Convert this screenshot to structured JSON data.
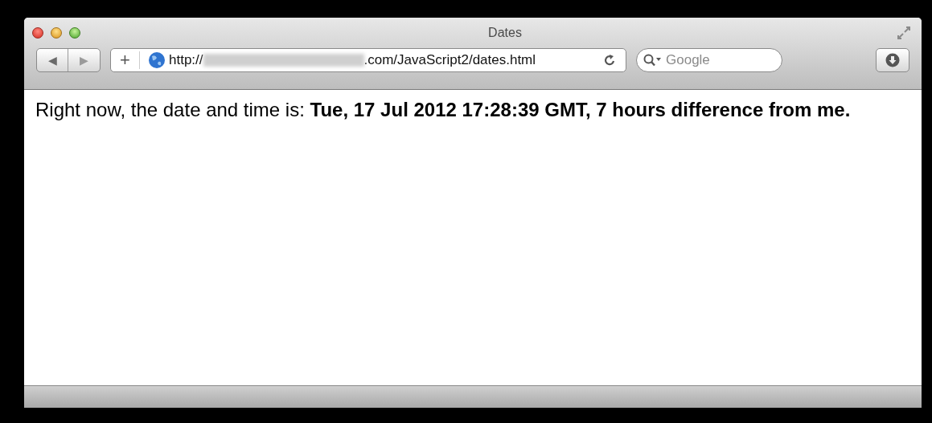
{
  "window": {
    "title": "Dates"
  },
  "toolbar": {
    "back": "◀",
    "forward": "▶",
    "add": "+",
    "url_start": "http://",
    "url_end": ".com/JavaScript2/dates.html",
    "search": {
      "placeholder": "Google"
    }
  },
  "content": {
    "text": "Right now, the date and time is: **Tue, 17 Jul 2012 17:28:39 GMT, 7 hours difference from me.**"
  }
}
